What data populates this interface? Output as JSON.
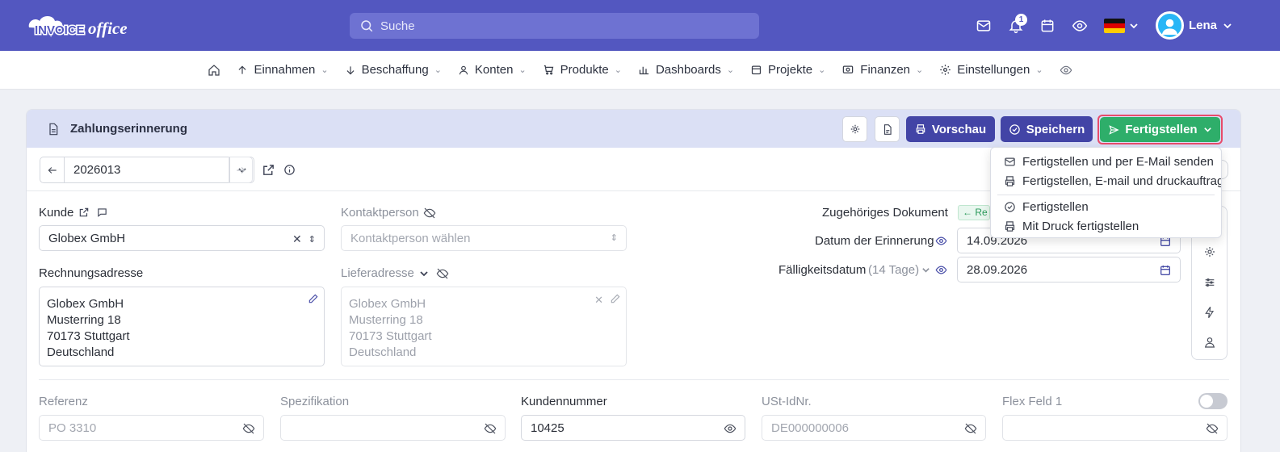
{
  "app": {
    "logo_text": "INVOICEoffice",
    "search_placeholder": "Suche",
    "notification_count": "1",
    "user_name": "Lena"
  },
  "menu": [
    {
      "label": "Einnahmen",
      "icon": "arrow-up-icon"
    },
    {
      "label": "Beschaffung",
      "icon": "arrow-down-icon"
    },
    {
      "label": "Konten",
      "icon": "person-icon"
    },
    {
      "label": "Produkte",
      "icon": "cart-icon"
    },
    {
      "label": "Dashboards",
      "icon": "bar-chart-icon"
    },
    {
      "label": "Projekte",
      "icon": "calendar-icon"
    },
    {
      "label": "Finanzen",
      "icon": "finance-icon"
    },
    {
      "label": "Einstellungen",
      "icon": "gear-icon"
    }
  ],
  "card": {
    "title": "Zahlungserinnerung",
    "preview_label": "Vorschau",
    "save_label": "Speichern",
    "finish_label": "Fertigstellen"
  },
  "dropdown": [
    "Fertigstellen und per E-Mail senden",
    "Fertigstellen, E-mail und druckauftrag",
    "Fertigstellen",
    "Mit Druck fertigstellen"
  ],
  "number": "2026013",
  "customer": {
    "label": "Kunde",
    "value": "Globex GmbH"
  },
  "contact": {
    "label": "Kontaktperson",
    "placeholder": "Kontaktperson wählen"
  },
  "billing": {
    "label": "Rechnungsadresse",
    "lines": [
      "Globex GmbH",
      "Musterring 18",
      "70173 Stuttgart",
      "Deutschland"
    ]
  },
  "delivery": {
    "label": "Lieferadresse",
    "lines": [
      "Globex GmbH",
      "Musterring 18",
      "70173 Stuttgart",
      "Deutschland"
    ]
  },
  "related": {
    "label": "Zugehöriges Dokument",
    "tag": "← Re"
  },
  "reminder_date": {
    "label": "Datum der Erinnerung",
    "value": "14.09.2026"
  },
  "due_date": {
    "label": "Fälligkeitsdatum",
    "hint": "(14 Tage)",
    "value": "28.09.2026"
  },
  "bottom": [
    {
      "label": "Referenz",
      "value": "PO 3310",
      "muted": true
    },
    {
      "label": "Spezifikation",
      "value": "",
      "muted": true
    },
    {
      "label": "Kundennummer",
      "value": "10425",
      "muted": false
    },
    {
      "label": "USt-IdNr.",
      "value": "DE000000006",
      "muted": true
    },
    {
      "label": "Flex Feld 1",
      "value": "",
      "muted": true
    }
  ],
  "colors": {
    "topbar": "#5357c0",
    "primary": "#4244a6",
    "success": "#2eae6a",
    "highlight": "#e84b6b"
  }
}
